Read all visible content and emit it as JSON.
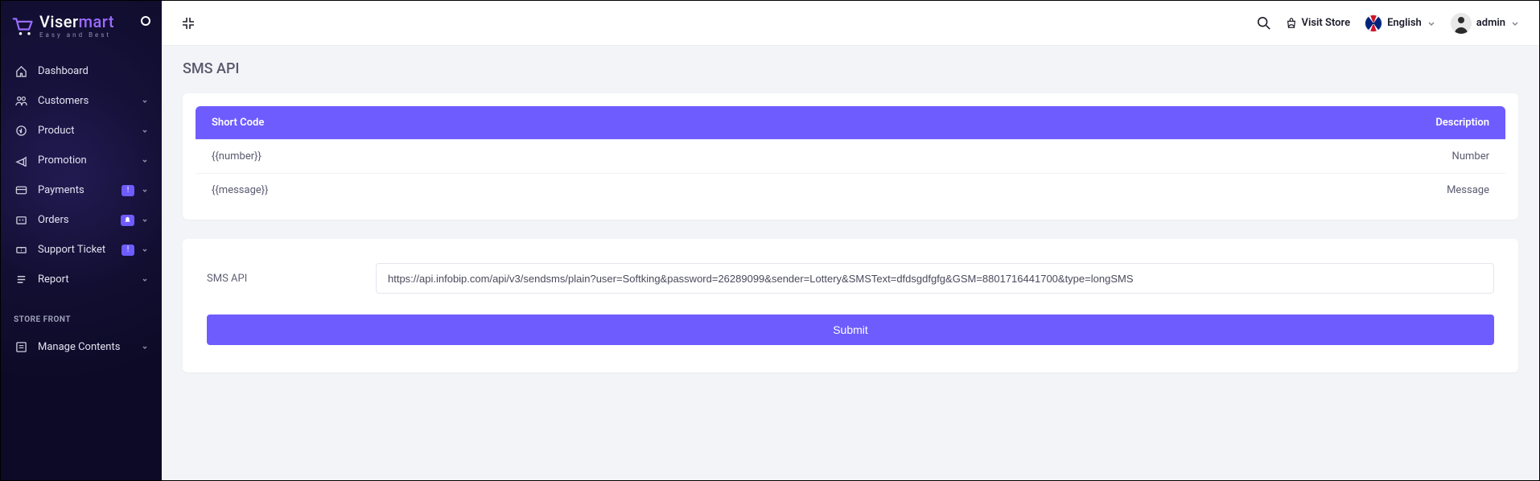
{
  "brand": {
    "word1": "Viser",
    "word2": "mart",
    "tagline": "Easy and Best"
  },
  "topbar": {
    "visit_store": "Visit Store",
    "language": "English",
    "user": "admin"
  },
  "sidebar": {
    "items": [
      {
        "label": "Dashboard",
        "icon": "home",
        "expandable": false
      },
      {
        "label": "Customers",
        "icon": "users",
        "expandable": true
      },
      {
        "label": "Product",
        "icon": "product",
        "expandable": true
      },
      {
        "label": "Promotion",
        "icon": "promo",
        "expandable": true
      },
      {
        "label": "Payments",
        "icon": "card",
        "expandable": true,
        "badge": "!"
      },
      {
        "label": "Orders",
        "icon": "orders",
        "expandable": true,
        "badge": "bell"
      },
      {
        "label": "Support Ticket",
        "icon": "ticket",
        "expandable": true,
        "badge": "!"
      },
      {
        "label": "Report",
        "icon": "report",
        "expandable": true
      }
    ],
    "section_label": "STORE FRONT",
    "front_items": [
      {
        "label": "Manage Contents",
        "icon": "contents",
        "expandable": true
      }
    ]
  },
  "page": {
    "title": "SMS API",
    "table": {
      "headers": {
        "code": "Short Code",
        "desc": "Description"
      },
      "rows": [
        {
          "code": "{{number}}",
          "desc": "Number"
        },
        {
          "code": "{{message}}",
          "desc": "Message"
        }
      ]
    },
    "form": {
      "label": "SMS API",
      "value": "https://api.infobip.com/api/v3/sendsms/plain?user=Softking&password=26289099&sender=Lottery&SMSText=dfdsgdfgfg&GSM=8801716441700&type=longSMS",
      "submit": "Submit"
    }
  }
}
